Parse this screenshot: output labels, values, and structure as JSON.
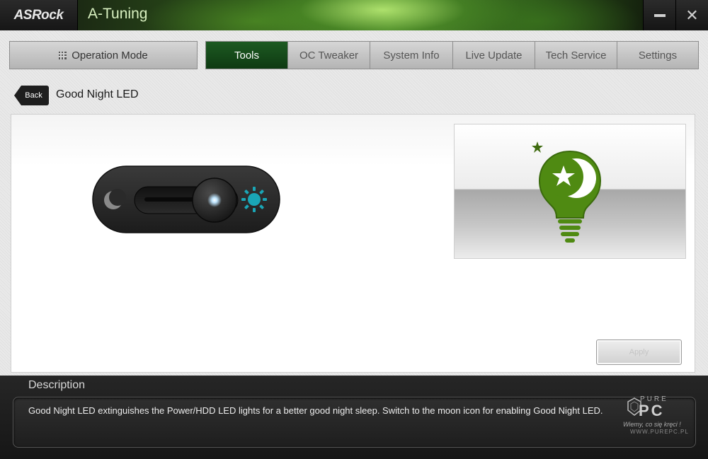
{
  "app": {
    "brand": "ASRock",
    "title": "A-Tuning"
  },
  "window_controls": {
    "minimize_icon": "minimize-icon",
    "close_icon": "close-icon"
  },
  "nav": {
    "operation_mode": "Operation Mode",
    "tabs": [
      {
        "label": "Tools",
        "active": true
      },
      {
        "label": "OC Tweaker",
        "active": false
      },
      {
        "label": "System Info",
        "active": false
      },
      {
        "label": "Live Update",
        "active": false
      },
      {
        "label": "Tech Service",
        "active": false
      },
      {
        "label": "Settings",
        "active": false
      }
    ]
  },
  "page": {
    "back_label": "Back",
    "title": "Good Night LED"
  },
  "toggle": {
    "left_icon": "moon-icon",
    "right_icon": "sun-icon",
    "state": "on"
  },
  "preview": {
    "icon": "good-night-bulb-icon"
  },
  "apply_label": "Apply",
  "description": {
    "title": "Description",
    "text": "Good Night LED extinguishes the Power/HDD LED lights for a better good night sleep. Switch to the moon icon for enabling Good Night LED."
  },
  "watermark": {
    "top": "PURE",
    "main": "PC",
    "tagline": "Wiemy, co się kręci !",
    "url": "WWW.PUREPC.PL"
  },
  "colors": {
    "accent_green": "#0e3a12",
    "bulb_green": "#4f8a12",
    "sun_cyan": "#1aa6b6"
  }
}
